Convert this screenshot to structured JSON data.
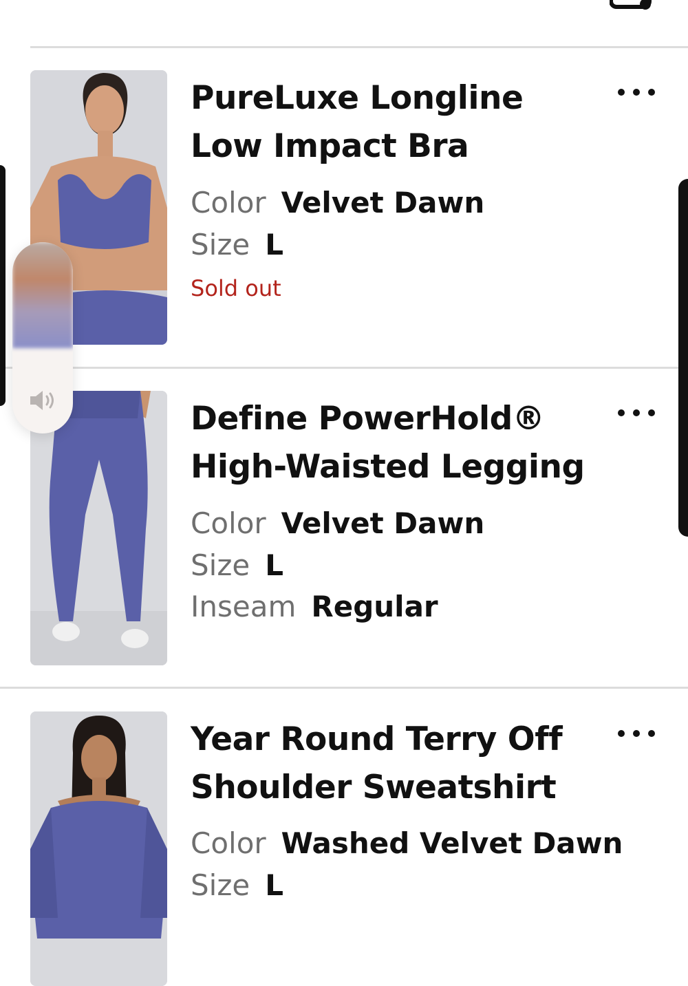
{
  "cart": {
    "icon": "bag-icon"
  },
  "items": [
    {
      "title": "PureLuxe Longline Low Impact Bra",
      "attributes": [
        {
          "label": "Color",
          "value": "Velvet Dawn"
        },
        {
          "label": "Size",
          "value": "L"
        }
      ],
      "status": "Sold out",
      "more_icon": "more-dots-icon"
    },
    {
      "title": "Define PowerHold® High-Waisted Legging",
      "attributes": [
        {
          "label": "Color",
          "value": "Velvet Dawn"
        },
        {
          "label": "Size",
          "value": "L"
        },
        {
          "label": "Inseam",
          "value": "Regular"
        }
      ],
      "more_icon": "more-dots-icon"
    },
    {
      "title": "Year Round Terry Off Shoulder Sweatshirt",
      "attributes": [
        {
          "label": "Color",
          "value": "Washed Velvet Dawn"
        },
        {
          "label": "Size",
          "value": "L"
        }
      ],
      "more_icon": "more-dots-icon"
    }
  ],
  "volume_hud": {
    "icon": "speaker-icon",
    "level": 0.55
  },
  "colors": {
    "text": "#111111",
    "muted": "#6f6f6f",
    "sold_out": "#b3241c",
    "product": "#5a60a8"
  }
}
